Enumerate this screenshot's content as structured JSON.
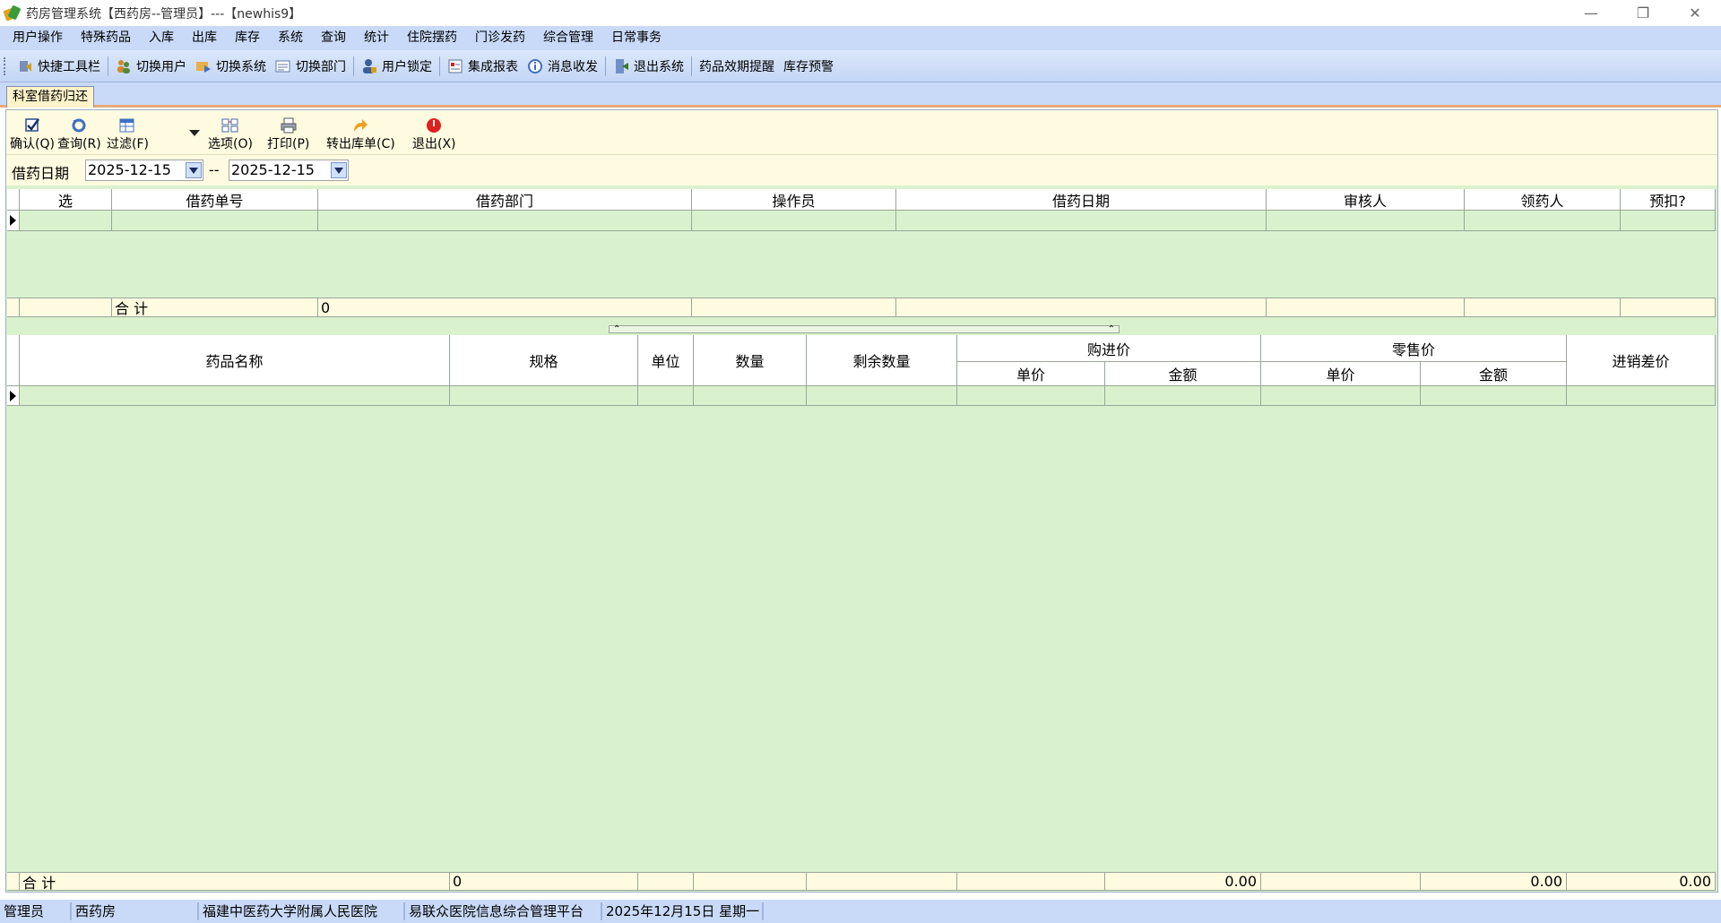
{
  "window": {
    "title": "药房管理系统【西药房--管理员】---【newhis9】"
  },
  "menu": [
    "用户操作",
    "特殊药品",
    "入库",
    "出库",
    "库存",
    "系统",
    "查询",
    "统计",
    "住院摆药",
    "门诊发药",
    "综合管理",
    "日常事务"
  ],
  "quick_toolbar": {
    "label": "快捷工具栏",
    "items": [
      "切换用户",
      "切换系统",
      "切换部门",
      "用户锁定",
      "集成报表",
      "消息收发",
      "退出系统",
      "药品效期提醒",
      "库存预警"
    ]
  },
  "doc_tab": "科室借药归还",
  "form_toolbar": [
    "确认(Q)",
    "查询(R)",
    "过滤(F)",
    "选项(O)",
    "打印(P)",
    "转出库单(C)",
    "退出(X)"
  ],
  "date_filter": {
    "label": "借药日期",
    "from": "2025-12-15",
    "separator": "--",
    "to": "2025-12-15"
  },
  "top_grid": {
    "columns": [
      "选",
      "借药单号",
      "借药部门",
      "操作员",
      "借药日期",
      "审核人",
      "领药人",
      "预扣?"
    ],
    "summary_label": "合  计",
    "summary_value": "0"
  },
  "bottom_grid": {
    "columns": {
      "name": "药品名称",
      "spec": "规格",
      "unit": "单位",
      "qty": "数量",
      "remain": "剩余数量",
      "purchase_group": "购进价",
      "purchase_unit": "单价",
      "purchase_amount": "金额",
      "retail_group": "零售价",
      "retail_unit": "单价",
      "retail_amount": "金额",
      "diff": "进销差价"
    },
    "summary": {
      "label": "合  计",
      "qty": "0",
      "purchase_amount": "0.00",
      "retail_amount": "0.00",
      "diff": "0.00"
    }
  },
  "status_bar": [
    "管理员",
    "西药房",
    "福建中医药大学附属人民医院",
    "易联众医院信息综合管理平台",
    "2025年12月15日  星期一"
  ]
}
